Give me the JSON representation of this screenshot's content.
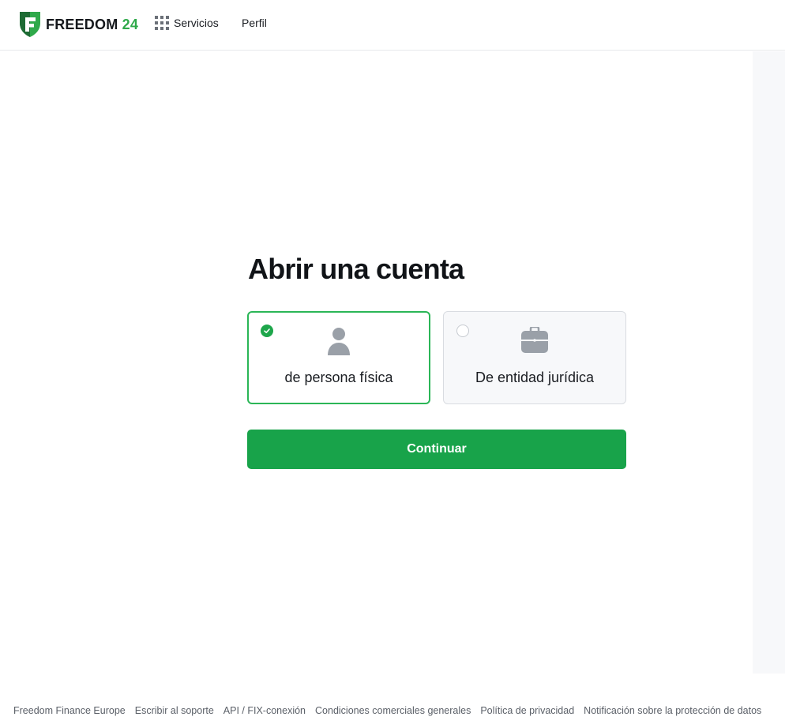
{
  "header": {
    "brand_word": "FREEDOM",
    "brand_number": "24",
    "brand_color": "#2fa94a",
    "nav": {
      "services_label": "Servicios",
      "profile_label": "Perfil"
    }
  },
  "main": {
    "title": "Abrir una cuenta",
    "account_types": [
      {
        "label": "de persona física",
        "icon": "user-icon",
        "selected": true
      },
      {
        "label": "De entidad jurídica",
        "icon": "briefcase-icon",
        "selected": false
      }
    ],
    "continue_label": "Continuar",
    "accent_color": "#18a34a"
  },
  "footer": {
    "links": [
      "Freedom Finance Europe",
      "Escribir al soporte",
      "API / FIX-conexión",
      "Condiciones comerciales generales",
      "Política de privacidad",
      "Notificación sobre la protección de datos"
    ]
  }
}
